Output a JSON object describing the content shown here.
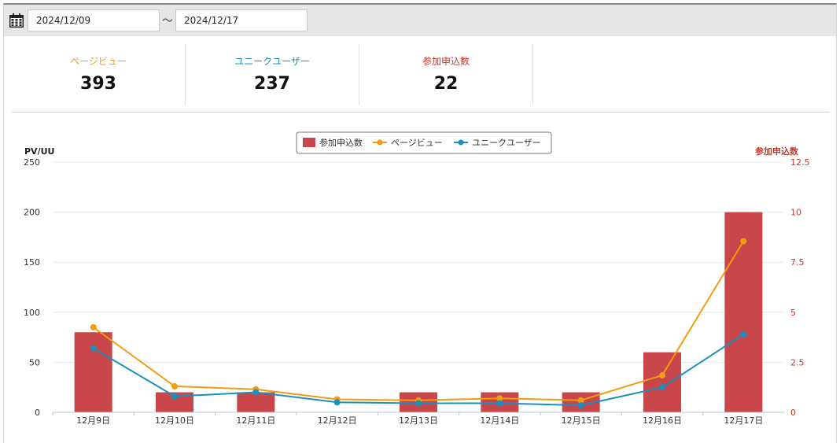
{
  "filter": {
    "date_from": "2024/12/09",
    "separator": "～",
    "date_to": "2024/12/17"
  },
  "stats": [
    {
      "label": "ページビュー",
      "value": "393",
      "color": "#f29c11"
    },
    {
      "label": "ユニークユーザー",
      "value": "237",
      "color": "#1b8fbe"
    },
    {
      "label": "参加申込数",
      "value": "22",
      "color": "#c0392b"
    }
  ],
  "colors": {
    "bar": "#c9474a",
    "pv": "#f29c11",
    "uu": "#1b8fbe",
    "right_axis": "#c0392b"
  },
  "chart_data": {
    "type": "bar",
    "categories": [
      "12月9日",
      "12月10日",
      "12月11日",
      "12月12日",
      "12月13日",
      "12月14日",
      "12月15日",
      "12月16日",
      "12月17日"
    ],
    "series": [
      {
        "name": "参加申込数",
        "type": "bar",
        "axis": "right",
        "values": [
          4,
          1,
          1,
          0,
          1,
          1,
          1,
          3,
          10
        ]
      },
      {
        "name": "ページビュー",
        "type": "line",
        "axis": "left",
        "values": [
          85,
          26,
          23,
          13,
          12,
          14,
          12,
          37,
          171
        ]
      },
      {
        "name": "ユニークユーザー",
        "type": "line",
        "axis": "left",
        "values": [
          64,
          16,
          20,
          10,
          9,
          9,
          7,
          25,
          78
        ]
      }
    ],
    "ylabel": "PV/UU",
    "ylim": [
      0,
      250
    ],
    "yticks": [
      "0",
      "50",
      "100",
      "150",
      "200",
      "250"
    ],
    "y2label": "参加申込数",
    "y2lim": [
      0,
      12.5
    ],
    "y2ticks": [
      "0",
      "2.5",
      "5",
      "7.5",
      "10",
      "12.5"
    ],
    "legend_position": "top-center",
    "grid": true
  }
}
